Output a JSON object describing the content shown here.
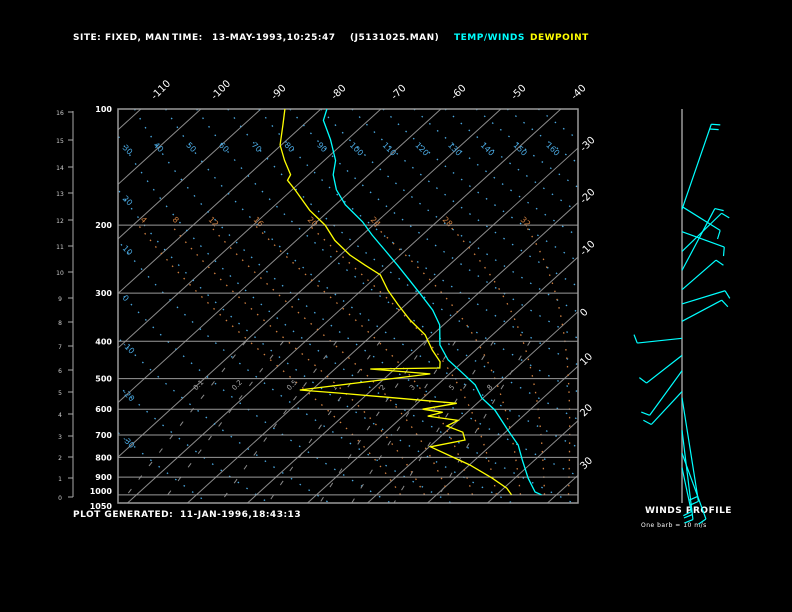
{
  "header": {
    "site_label": "SITE:",
    "site_value": "FIXED, MAN",
    "time_label": "TIME:",
    "time_value": "13-MAY-1993,10:25:47",
    "file_name": "(J5131025.MAN)",
    "legend_temp": "TEMP/WINDS",
    "legend_dew": "DEWPOINT"
  },
  "footer": {
    "generated_label": "PLOT GENERATED:",
    "generated_value": "11-JAN-1996,18:43:13"
  },
  "winds_panel": {
    "title": "WINDS PROFILE",
    "note": "One barb = 10 m/s"
  },
  "colors": {
    "temp": "#00ffff",
    "dew": "#ffff00",
    "isotherm": "#8c8c8c",
    "dry_adiabat": "#4aa8e0",
    "moist_adiabat": "#d08040",
    "mixing_ratio": "#8c8c8c",
    "frame": "#9a9a9a"
  },
  "chart_data": {
    "type": "line",
    "title": "Skew-T log-P sounding",
    "pressure_levels": [
      100,
      200,
      300,
      400,
      500,
      600,
      700,
      800,
      900,
      1000,
      1050
    ],
    "pressure_labels": [
      "100",
      "200",
      "300",
      "400",
      "500",
      "600",
      "700",
      "800",
      "900",
      "1000",
      "1050"
    ],
    "pressure_range": [
      100,
      1050
    ],
    "height_km_ticks": [
      "0",
      "1",
      "2",
      "3",
      "4",
      "5",
      "6",
      "7",
      "8",
      "9",
      "10",
      "11",
      "12",
      "13",
      "14",
      "15",
      "16"
    ],
    "top_temp_labels": [
      "-110",
      "-100",
      "-90",
      "-80",
      "-70",
      "-60",
      "-50",
      "-40"
    ],
    "right_temp_labels": [
      "-30",
      "-20",
      "-10",
      "0",
      "10",
      "20",
      "30"
    ],
    "isotherms_step_c": 10,
    "dry_adiabat_labels": [
      "-30",
      "-20",
      "-10",
      "0",
      "10",
      "20",
      "30",
      "40",
      "50",
      "60",
      "70",
      "80",
      "90",
      "100",
      "110",
      "120",
      "130",
      "140",
      "150",
      "160"
    ],
    "moist_adiabat_labels": [
      "4",
      "8",
      "12",
      "16",
      "20",
      "24",
      "28",
      "32"
    ],
    "mixing_ratio_labels": [
      "0.1",
      "0.2",
      "0.5",
      "1",
      "2",
      "3",
      "5",
      "8"
    ],
    "series": [
      {
        "name": "TEMP/WINDS",
        "points": [
          [
            100,
            -79.0
          ],
          [
            107,
            -77.5
          ],
          [
            120,
            -72.8
          ],
          [
            136,
            -68.1
          ],
          [
            148,
            -65.9
          ],
          [
            162,
            -62.6
          ],
          [
            177,
            -58.4
          ],
          [
            196,
            -52.4
          ],
          [
            212,
            -48.4
          ],
          [
            232,
            -43.5
          ],
          [
            254,
            -38.6
          ],
          [
            278,
            -33.8
          ],
          [
            304,
            -29.1
          ],
          [
            332,
            -24.5
          ],
          [
            363,
            -20.6
          ],
          [
            409,
            -16.9
          ],
          [
            447,
            -12.8
          ],
          [
            481,
            -8.3
          ],
          [
            519,
            -3.7
          ],
          [
            561,
            -0.2
          ],
          [
            603,
            4.2
          ],
          [
            679,
            10.0
          ],
          [
            743,
            14.5
          ],
          [
            812,
            17.9
          ],
          [
            905,
            22.2
          ],
          [
            983,
            25.9
          ],
          [
            1000,
            27.5
          ]
        ]
      },
      {
        "name": "DEWPOINT",
        "points": [
          [
            100,
            -86.0
          ],
          [
            110,
            -83.4
          ],
          [
            124,
            -80.2
          ],
          [
            136,
            -76.6
          ],
          [
            148,
            -73.0
          ],
          [
            153,
            -72.5
          ],
          [
            162,
            -69.5
          ],
          [
            183,
            -63.3
          ],
          [
            200,
            -58.0
          ],
          [
            219,
            -53.6
          ],
          [
            239,
            -48.4
          ],
          [
            254,
            -44.0
          ],
          [
            269,
            -39.7
          ],
          [
            295,
            -35.6
          ],
          [
            322,
            -31.2
          ],
          [
            352,
            -26.5
          ],
          [
            385,
            -21.2
          ],
          [
            421,
            -17.3
          ],
          [
            452,
            -13.8
          ],
          [
            469,
            -12.7
          ],
          [
            472,
            -24.1
          ],
          [
            486,
            -13.2
          ],
          [
            535,
            -32.0
          ],
          [
            545,
            -24.8
          ],
          [
            579,
            -3.4
          ],
          [
            600,
            -8.0
          ],
          [
            611,
            -4.1
          ],
          [
            625,
            -5.9
          ],
          [
            641,
            -0.1
          ],
          [
            663,
            -0.9
          ],
          [
            688,
            2.9
          ],
          [
            721,
            4.7
          ],
          [
            751,
            0.2
          ],
          [
            788,
            4.6
          ],
          [
            837,
            10.1
          ],
          [
            905,
            16.2
          ],
          [
            961,
            20.5
          ],
          [
            1000,
            22.5
          ]
        ]
      }
    ],
    "winds": [
      {
        "p": 182,
        "dir": 19,
        "spd": 18
      },
      {
        "p": 179,
        "dir": 122,
        "spd": 9
      },
      {
        "p": 208,
        "dir": 110,
        "spd": 9
      },
      {
        "p": 234,
        "dir": 46,
        "spd": 11
      },
      {
        "p": 262,
        "dir": 28,
        "spd": 14
      },
      {
        "p": 294,
        "dir": 49,
        "spd": 9
      },
      {
        "p": 320,
        "dir": 73,
        "spd": 9
      },
      {
        "p": 355,
        "dir": 62,
        "spd": 9
      },
      {
        "p": 393,
        "dir": 264,
        "spd": 9
      },
      {
        "p": 435,
        "dir": 232,
        "spd": 9
      },
      {
        "p": 477,
        "dir": 216,
        "spd": 11
      },
      {
        "p": 540,
        "dir": 223,
        "spd": 9
      },
      {
        "p": 560,
        "dir": 171,
        "spd": 21
      },
      {
        "p": 680,
        "dir": 173,
        "spd": 18
      },
      {
        "p": 780,
        "dir": 160,
        "spd": 14
      },
      {
        "p": 850,
        "dir": 168,
        "spd": 9
      }
    ]
  }
}
